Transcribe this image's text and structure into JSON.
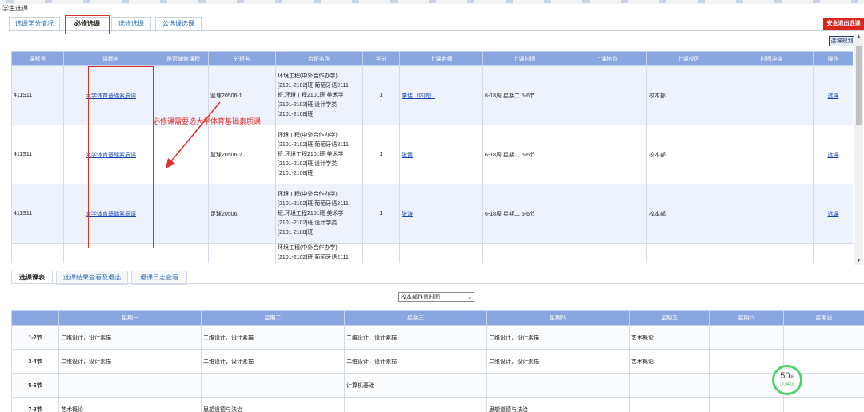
{
  "page_title": "学生选课",
  "top_tabs": [
    "选课学分情况",
    "必修选课",
    "选修选课",
    "公选课选课"
  ],
  "exit_button": "安全退出选课",
  "plan_button": "选课规划",
  "course_table": {
    "headers": [
      "课程号",
      "课程名",
      "是否辅修课程",
      "分班名",
      "合班名称",
      "学分",
      "上课老师",
      "上课时间",
      "上课地点",
      "上课校区",
      "时间冲突",
      "操作"
    ],
    "rows": [
      {
        "code": "411S11",
        "name": "大学体育基础素质课",
        "minor": "",
        "section": "篮球20506-1",
        "classes": [
          "环境工程(中外合作办学)",
          "[2101-2102]班,葡萄牙语2111",
          "班,环境工程2101班,美术学",
          "[2101-2102]班,设计学类",
          "[2101-2108]班"
        ],
        "credit": "1",
        "teacher": "李佳（体院）",
        "time": "6-18周 星期二 5-6节",
        "place": "",
        "campus": "校本部",
        "conflict": "",
        "action": "选课"
      },
      {
        "code": "411S11",
        "name": "大学体育基础素质课",
        "minor": "",
        "section": "篮球20506-2",
        "classes": [
          "环境工程(中外合作办学)",
          "[2101-2102]班,葡萄牙语2111",
          "班,环境工程2101班,美术学",
          "[2101-2102]班,设计学类",
          "[2101-2108]班"
        ],
        "credit": "1",
        "teacher": "张健",
        "time": "6-18周 星期二 5-6节",
        "place": "",
        "campus": "校本部",
        "conflict": "",
        "action": "选课"
      },
      {
        "code": "411S11",
        "name": "大学体育基础素质课",
        "minor": "",
        "section": "足球20506",
        "classes": [
          "环境工程(中外合作办学)",
          "[2101-2102]班,葡萄牙语2111",
          "班,环境工程2101班,美术学",
          "[2101-2102]班,设计学类",
          "[2101-2108]班"
        ],
        "credit": "1",
        "teacher": "张涛",
        "time": "6-18周 星期二 5-6节",
        "place": "",
        "campus": "校本部",
        "conflict": "",
        "action": "选课"
      },
      {
        "code": "",
        "name": "",
        "minor": "",
        "section": "",
        "classes": [
          "环境工程(中外合作办学)",
          "[2101-2102]班,葡萄牙语2111"
        ],
        "credit": "",
        "teacher": "",
        "time": "",
        "place": "",
        "campus": "",
        "conflict": "",
        "action": ""
      }
    ]
  },
  "annotation": "必修课需要选大学体育基础素质课",
  "bottom_tabs": [
    "选课课表",
    "选课结果查看及退选",
    "退课日志查看"
  ],
  "schedule_select": "校本部作息时间",
  "schedule_table": {
    "headers": [
      "",
      "星期一",
      "星期二",
      "星期三",
      "星期四",
      "星期五",
      "星期六",
      "星期日"
    ],
    "rows": [
      {
        "slot": "1-2节",
        "cells": [
          "二维设计，设计素描",
          "二维设计，设计素描",
          "二维设计，设计素描",
          "二维设计，设计素描",
          "艺术概论",
          "",
          ""
        ]
      },
      {
        "slot": "3-4节",
        "cells": [
          "二维设计，设计素描",
          "二维设计，设计素描",
          "二维设计，设计素描",
          "二维设计，设计素描",
          "艺术概论",
          "",
          ""
        ]
      },
      {
        "slot": "5-6节",
        "cells": [
          "",
          "",
          "计算机基础",
          "",
          "",
          "",
          ""
        ]
      },
      {
        "slot": "7-8节",
        "cells": [
          "艺术概论",
          "思想道德与法治",
          "",
          "思想道德与法治",
          "",
          "",
          ""
        ]
      }
    ]
  },
  "gauge": {
    "percent": "50",
    "unit": "%",
    "speed": "↑0.04K/s"
  },
  "colors": {
    "header_bg": "#8aa6e0",
    "link": "#1b46b8",
    "annotation": "#e0302b",
    "exit_bg": "#d9261c",
    "gauge": "#4cd36a"
  }
}
